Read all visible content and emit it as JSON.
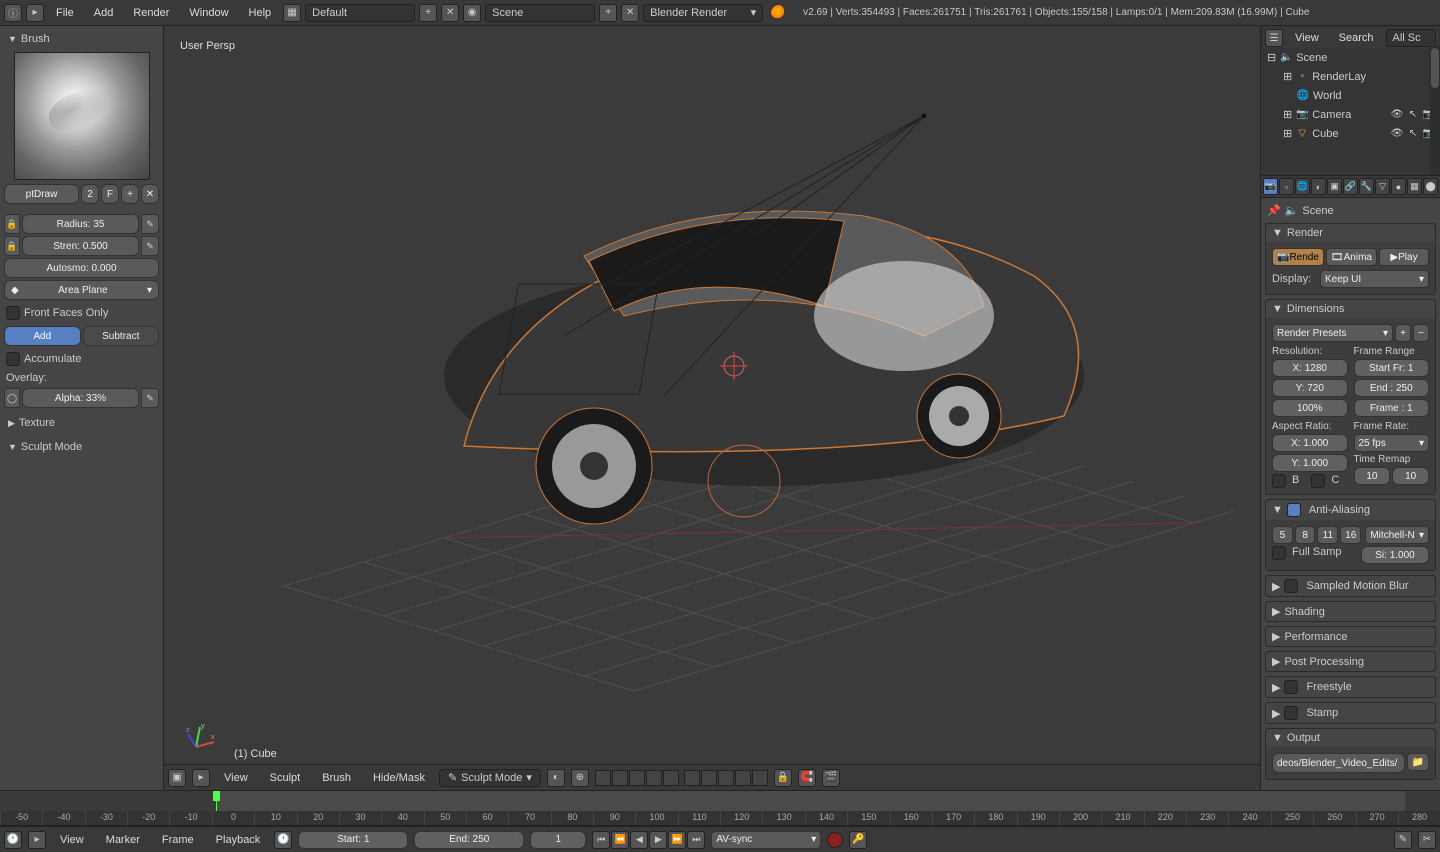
{
  "topbar": {
    "menus": [
      "File",
      "Add",
      "Render",
      "Window",
      "Help"
    ],
    "layout": "Default",
    "scene": "Scene",
    "engine": "Blender Render",
    "version": "v2.69",
    "stats": "Verts:354493 | Faces:261751 | Tris:261761 | Objects:155/158 | Lamps:0/1 | Mem:209.83M (16.99M) | Cube"
  },
  "brush_panel": {
    "title": "Brush",
    "name": "ptDraw",
    "users": "2",
    "fake": "F",
    "radius_lbl": "Radius: 35",
    "strength_lbl": "Stren: 0.500",
    "autosmooth_lbl": "Autosmo: 0.000",
    "plane": "Area Plane",
    "front_faces": "Front Faces Only",
    "add": "Add",
    "subtract": "Subtract",
    "accumulate": "Accumulate",
    "overlay": "Overlay:",
    "alpha": "Alpha: 33%",
    "texture": "Texture",
    "sculpt_mode": "Sculpt Mode"
  },
  "viewport": {
    "persp": "User Persp",
    "object": "(1) Cube",
    "footer_menus": [
      "View",
      "Sculpt",
      "Brush",
      "Hide/Mask"
    ],
    "mode": "Sculpt Mode"
  },
  "outliner": {
    "view": "View",
    "search": "Search",
    "all": "All Sc",
    "items": [
      {
        "label": "Scene",
        "indent": 0,
        "icon": "🔈",
        "expand": "⊟"
      },
      {
        "label": "RenderLay",
        "indent": 1,
        "icon": "▫",
        "expand": "⊞"
      },
      {
        "label": "World",
        "indent": 1,
        "icon": "🌐",
        "expand": ""
      },
      {
        "label": "Camera",
        "indent": 1,
        "icon": "📷",
        "expand": "⊞",
        "restrict": true
      },
      {
        "label": "Cube",
        "indent": 1,
        "icon": "▽",
        "expand": "⊞",
        "restrict": true,
        "orange": true
      }
    ]
  },
  "props": {
    "crumb": "Scene",
    "render": {
      "title": "Render",
      "render_btn": "Rende",
      "anim_btn": "Anima",
      "play_btn": "Play",
      "display_lbl": "Display:",
      "display_val": "Keep UI"
    },
    "dimensions": {
      "title": "Dimensions",
      "presets": "Render Presets",
      "resolution_lbl": "Resolution:",
      "x": "X: 1280",
      "y": "Y: 720",
      "pct": "100%",
      "framerange_lbl": "Frame Range",
      "start": "Start Fr: 1",
      "end": "End : 250",
      "step": "Frame : 1",
      "aspect_lbl": "Aspect Ratio:",
      "ax": "X: 1.000",
      "ay": "Y: 1.000",
      "framerate_lbl": "Frame Rate:",
      "fps": "25 fps",
      "remap_lbl": "Time Remap",
      "remap1": "10",
      "remap2": "10",
      "border_b": "B",
      "border_c": "C"
    },
    "aa": {
      "title": "Anti-Aliasing",
      "s5": "5",
      "s8": "8",
      "s11": "11",
      "s16": "16",
      "filter": "Mitchell-N",
      "fullsamp": "Full Samp",
      "size": "Si: 1.000"
    },
    "collapsed": [
      "Sampled Motion Blur",
      "Shading",
      "Performance",
      "Post Processing",
      "Freestyle",
      "Stamp",
      "Output"
    ],
    "output_path": "deos/Blender_Video_Edits/"
  },
  "timeline": {
    "menus": [
      "View",
      "Marker",
      "Frame",
      "Playback"
    ],
    "start": "Start: 1",
    "end": "End: 250",
    "current": "1",
    "sync": "AV-sync",
    "ticks": [
      "-50",
      "-40",
      "-30",
      "-20",
      "-10",
      "0",
      "10",
      "20",
      "30",
      "40",
      "50",
      "60",
      "70",
      "80",
      "90",
      "100",
      "110",
      "120",
      "130",
      "140",
      "150",
      "160",
      "170",
      "180",
      "190",
      "200",
      "210",
      "220",
      "230",
      "240",
      "250",
      "260",
      "270",
      "280"
    ]
  }
}
